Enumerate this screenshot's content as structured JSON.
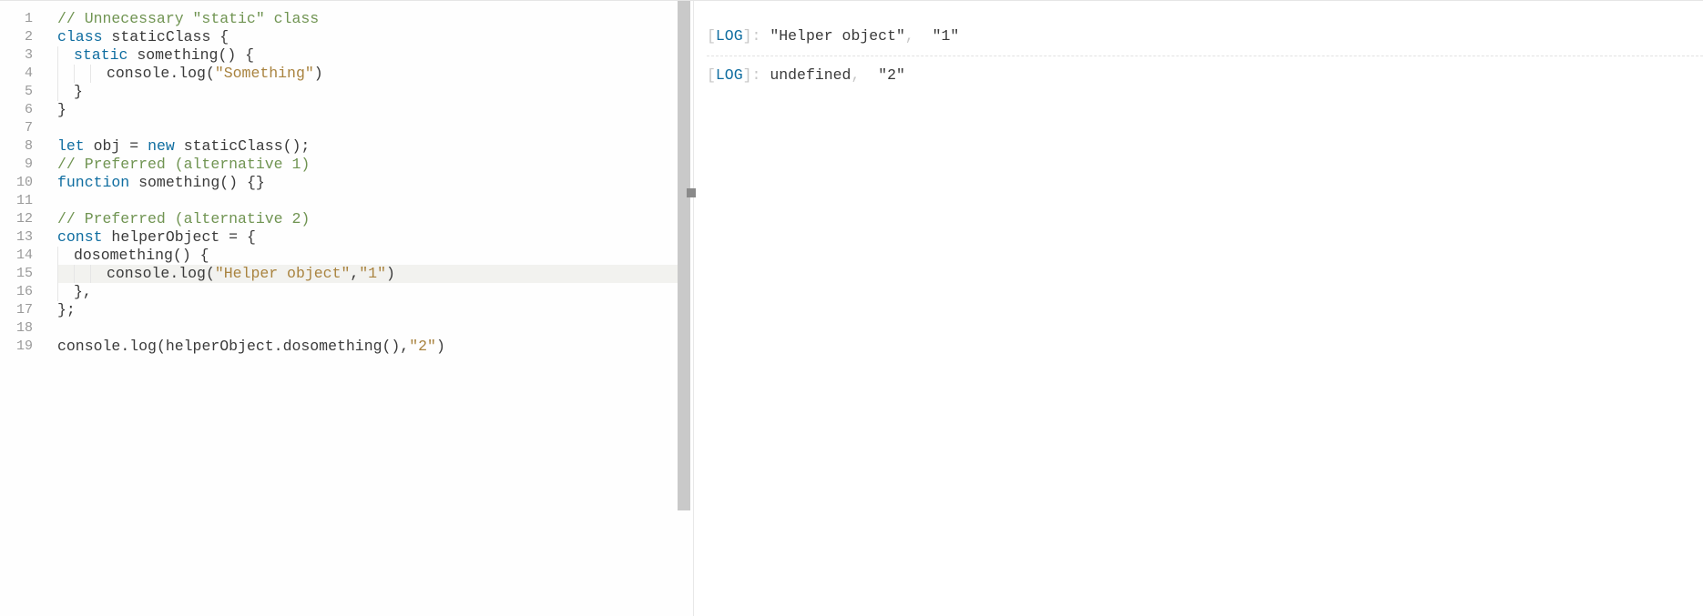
{
  "editor": {
    "totalLines": 19,
    "currentLine": 15,
    "lines": [
      {
        "n": 1,
        "tokens": [
          {
            "t": "// Unnecessary \"static\" class",
            "cls": "c"
          }
        ]
      },
      {
        "n": 2,
        "tokens": [
          {
            "t": "class",
            "cls": "k"
          },
          {
            "t": " ",
            "cls": "p"
          },
          {
            "t": "staticClass",
            "cls": "p"
          },
          {
            "t": " {",
            "cls": "p"
          }
        ]
      },
      {
        "n": 3,
        "indent": 1,
        "tokens": [
          {
            "t": "static",
            "cls": "k"
          },
          {
            "t": " ",
            "cls": "p"
          },
          {
            "t": "something",
            "cls": "p"
          },
          {
            "t": "() {",
            "cls": "p"
          }
        ]
      },
      {
        "n": 4,
        "indent": 3,
        "tokens": [
          {
            "t": "console",
            "cls": "p"
          },
          {
            "t": ".",
            "cls": "p"
          },
          {
            "t": "log",
            "cls": "p"
          },
          {
            "t": "(",
            "cls": "p"
          },
          {
            "t": "\"Something\"",
            "cls": "s"
          },
          {
            "t": ")",
            "cls": "p"
          }
        ]
      },
      {
        "n": 5,
        "indent": 1,
        "tokens": [
          {
            "t": "}",
            "cls": "p"
          }
        ]
      },
      {
        "n": 6,
        "tokens": [
          {
            "t": "}",
            "cls": "p"
          }
        ]
      },
      {
        "n": 7,
        "tokens": []
      },
      {
        "n": 8,
        "tokens": [
          {
            "t": "let",
            "cls": "k"
          },
          {
            "t": " ",
            "cls": "p"
          },
          {
            "t": "obj",
            "cls": "p"
          },
          {
            "t": " = ",
            "cls": "p"
          },
          {
            "t": "new",
            "cls": "k"
          },
          {
            "t": " ",
            "cls": "p"
          },
          {
            "t": "staticClass",
            "cls": "p"
          },
          {
            "t": "();",
            "cls": "p"
          }
        ]
      },
      {
        "n": 9,
        "tokens": [
          {
            "t": "// Preferred (alternative 1)",
            "cls": "c"
          }
        ]
      },
      {
        "n": 10,
        "tokens": [
          {
            "t": "function",
            "cls": "k"
          },
          {
            "t": " ",
            "cls": "p"
          },
          {
            "t": "something",
            "cls": "p"
          },
          {
            "t": "() {}",
            "cls": "p"
          }
        ]
      },
      {
        "n": 11,
        "tokens": []
      },
      {
        "n": 12,
        "tokens": [
          {
            "t": "// Preferred (alternative 2)",
            "cls": "c"
          }
        ]
      },
      {
        "n": 13,
        "tokens": [
          {
            "t": "const",
            "cls": "k"
          },
          {
            "t": " ",
            "cls": "p"
          },
          {
            "t": "helperObject",
            "cls": "p"
          },
          {
            "t": " = {",
            "cls": "p"
          }
        ]
      },
      {
        "n": 14,
        "indent": 1,
        "tokens": [
          {
            "t": "dosomething",
            "cls": "p"
          },
          {
            "t": "() {",
            "cls": "p"
          }
        ]
      },
      {
        "n": 15,
        "indent": 3,
        "tokens": [
          {
            "t": "console",
            "cls": "p"
          },
          {
            "t": ".",
            "cls": "p"
          },
          {
            "t": "log",
            "cls": "p"
          },
          {
            "t": "(",
            "cls": "p"
          },
          {
            "t": "\"Helper object\"",
            "cls": "s"
          },
          {
            "t": ",",
            "cls": "p"
          },
          {
            "t": "\"1\"",
            "cls": "s"
          },
          {
            "t": ")",
            "cls": "p"
          }
        ]
      },
      {
        "n": 16,
        "indent": 1,
        "tokens": [
          {
            "t": "},",
            "cls": "p"
          }
        ]
      },
      {
        "n": 17,
        "tokens": [
          {
            "t": "};",
            "cls": "p"
          }
        ]
      },
      {
        "n": 18,
        "tokens": []
      },
      {
        "n": 19,
        "tokens": [
          {
            "t": "console",
            "cls": "p"
          },
          {
            "t": ".",
            "cls": "p"
          },
          {
            "t": "log",
            "cls": "p"
          },
          {
            "t": "(",
            "cls": "p"
          },
          {
            "t": "helperObject",
            "cls": "p"
          },
          {
            "t": ".",
            "cls": "p"
          },
          {
            "t": "dosomething",
            "cls": "p"
          },
          {
            "t": "(),",
            "cls": "p"
          },
          {
            "t": "\"2\"",
            "cls": "s"
          },
          {
            "t": ")",
            "cls": "p"
          }
        ]
      }
    ]
  },
  "output": {
    "logs": [
      {
        "prefixOpen": "[",
        "tag": "LOG",
        "prefixClose": "]: ",
        "parts": [
          {
            "t": "\"Helper object\"",
            "cls": "p"
          },
          {
            "t": ",  ",
            "cls": "g"
          },
          {
            "t": "\"1\"",
            "cls": "p"
          }
        ]
      },
      {
        "prefixOpen": "[",
        "tag": "LOG",
        "prefixClose": "]: ",
        "parts": [
          {
            "t": "undefined",
            "cls": "p"
          },
          {
            "t": ",  ",
            "cls": "g"
          },
          {
            "t": "\"2\"",
            "cls": "p"
          }
        ]
      }
    ]
  }
}
